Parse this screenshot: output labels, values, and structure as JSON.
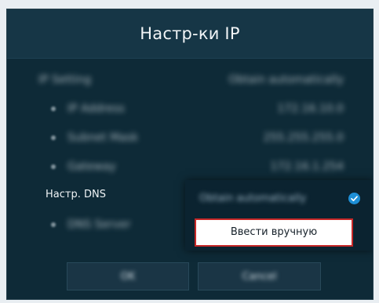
{
  "dialog": {
    "title": "Настр-ки IP"
  },
  "settings": {
    "ip_setting": {
      "label": "IP Setting",
      "value": "Obtain automatically"
    },
    "ip_address": {
      "label": "IP Address",
      "value": "172.16.10.0"
    },
    "subnet_mask": {
      "label": "Subnet Mask",
      "value": "255.255.255.0"
    },
    "gateway": {
      "label": "Gateway",
      "value": "172.16.1.254"
    },
    "dns_setting": {
      "label": "Настр. DNS"
    },
    "dns_server": {
      "label": "DNS Server"
    }
  },
  "dns_dropdown": {
    "selected_option": "Obtain automatically",
    "manual_option": "Ввести вручную"
  },
  "footer": {
    "ok_label": "OK",
    "cancel_label": "Cancel"
  }
}
